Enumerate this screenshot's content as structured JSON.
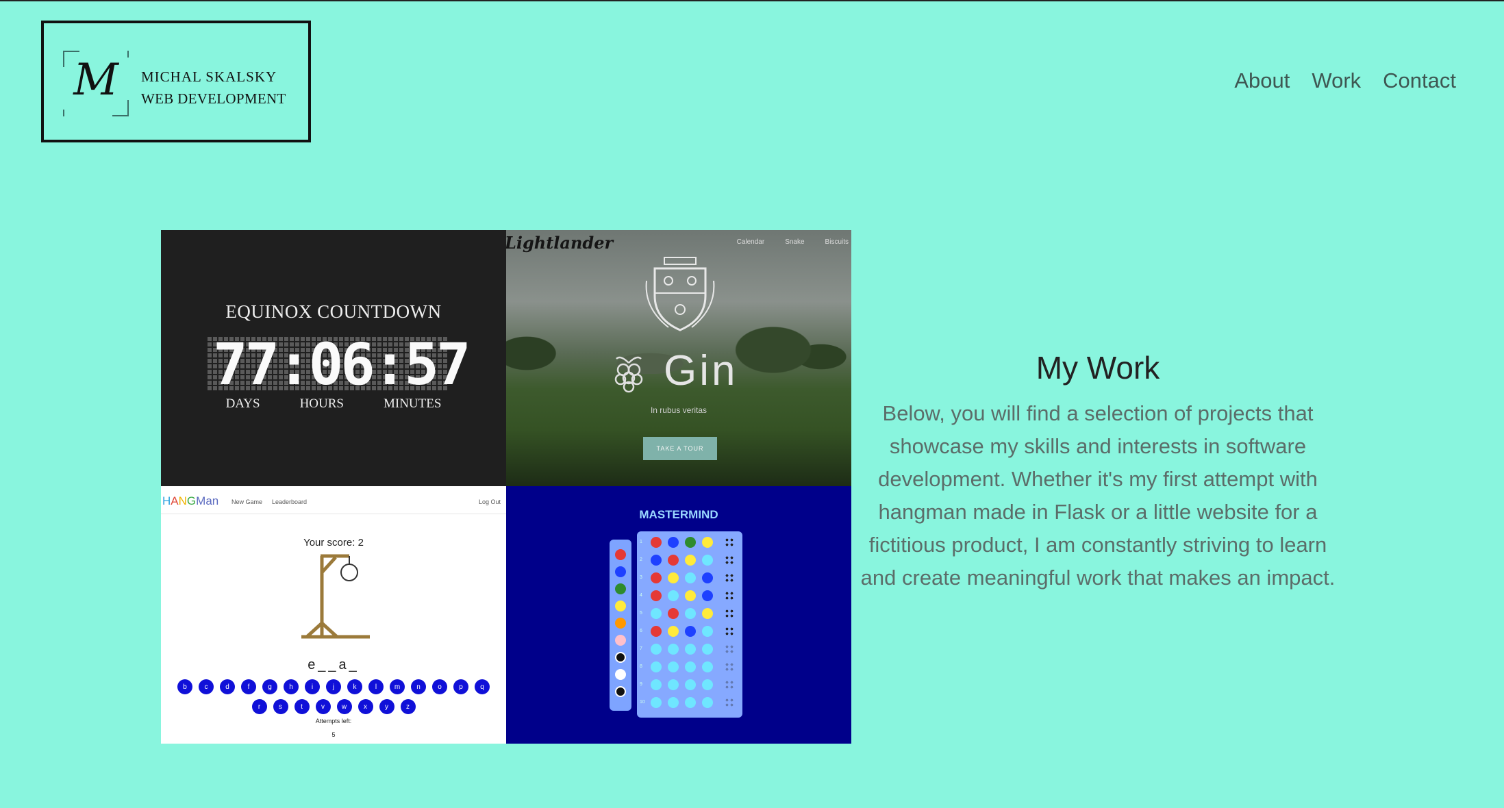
{
  "logo": {
    "monogram": "M",
    "name": "MICHAL SKALSKY",
    "subtitle": "WEB DEVELOPMENT"
  },
  "nav": {
    "items": [
      "About",
      "Work",
      "Contact"
    ]
  },
  "gallery": {
    "equinox": {
      "title": "EQUINOX COUNTDOWN",
      "digits": "77:06:57",
      "labels": [
        "DAYS",
        "HOURS",
        "MINUTES"
      ]
    },
    "gin": {
      "brand": "Lightlander",
      "menu": [
        "Calendar",
        "Snake",
        "Biscuits"
      ],
      "title": "Gin",
      "motto": "In rubus veritas",
      "button": "TAKE A TOUR"
    },
    "hangman": {
      "logo": "HANGMan",
      "nav": [
        "New Game",
        "Leaderboard"
      ],
      "logout": "Log Out",
      "score": "Your score: 2",
      "word": "e__a_",
      "keys": [
        "b",
        "c",
        "d",
        "f",
        "g",
        "h",
        "i",
        "j",
        "k",
        "l",
        "m",
        "n",
        "o",
        "p",
        "q",
        "r",
        "s",
        "t",
        "v",
        "w",
        "x",
        "y",
        "z"
      ],
      "attempts_label": "Attempts left:",
      "attempts_value": "5"
    },
    "mastermind": {
      "title": "MASTERMIND",
      "row_numbers": [
        "1",
        "2",
        "3",
        "4",
        "5",
        "6",
        "7",
        "8",
        "9",
        "10"
      ]
    }
  },
  "work": {
    "heading": "My Work",
    "description": "Below, you will find a selection of projects that showcase my skills and interests in software development. Whether it's my first attempt with hangman made in Flask or a little website for a fictitious product, I am constantly striving to learn and create meaningful work that makes an impact."
  },
  "colors": {
    "background": "#89f5de",
    "mastermind_bg": "#00008a",
    "hangman_key": "#1010d8"
  }
}
